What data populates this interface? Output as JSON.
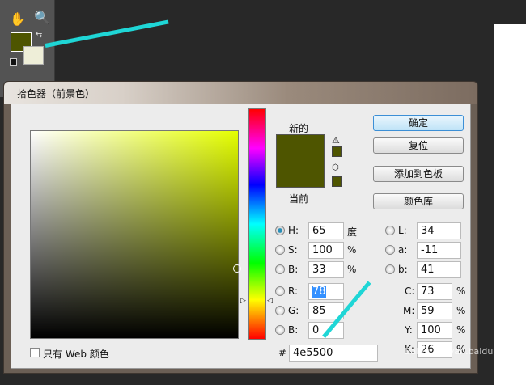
{
  "dialog_title": "拾色器（前景色）",
  "swatch": {
    "new_label": "新的",
    "current_label": "当前",
    "new_color": "#4e5500",
    "current_color": "#4e5500"
  },
  "toolbar": {
    "foreground_color": "#4e5500",
    "background_color": "#eeeed8"
  },
  "buttons": {
    "ok": "确定",
    "reset": "复位",
    "add_swatch": "添加到色板",
    "libraries": "颜色库"
  },
  "hsb": [
    {
      "label": "H:",
      "value": "65",
      "unit": "度"
    },
    {
      "label": "S:",
      "value": "100",
      "unit": "%"
    },
    {
      "label": "B:",
      "value": "33",
      "unit": "%"
    }
  ],
  "rgb": [
    {
      "label": "R:",
      "value": "78"
    },
    {
      "label": "G:",
      "value": "85"
    },
    {
      "label": "B:",
      "value": "0"
    }
  ],
  "lab": [
    {
      "label": "L:",
      "value": "34"
    },
    {
      "label": "a:",
      "value": "-11"
    },
    {
      "label": "b:",
      "value": "41"
    }
  ],
  "cmyk": [
    {
      "label": "C:",
      "value": "73",
      "unit": "%"
    },
    {
      "label": "M:",
      "value": "59",
      "unit": "%"
    },
    {
      "label": "Y:",
      "value": "100",
      "unit": "%"
    },
    {
      "label": "K:",
      "value": "26",
      "unit": "%"
    }
  ],
  "hex": {
    "label": "#",
    "value": "4e5500"
  },
  "web_only": "只有 Web 颜色",
  "watermark": "Baidu jingyan.baidu"
}
